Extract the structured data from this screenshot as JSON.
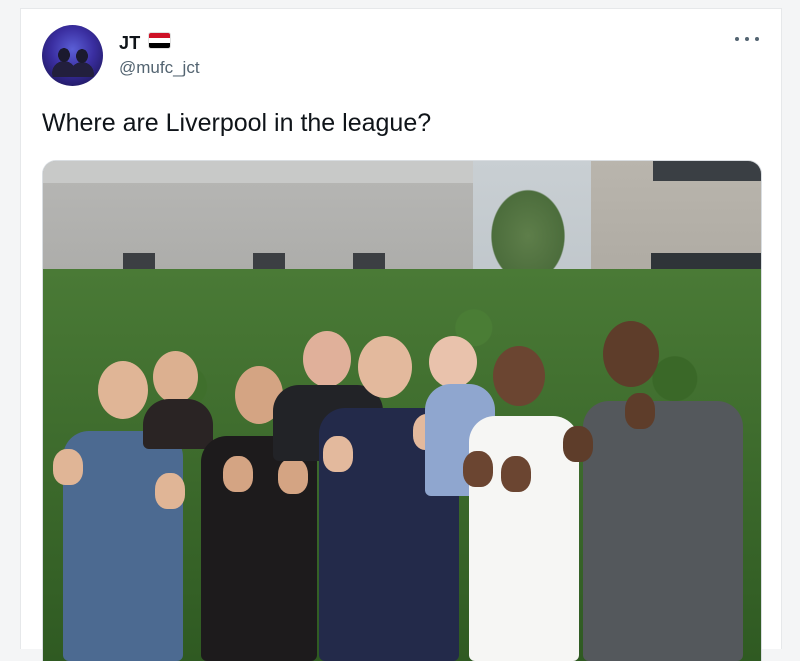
{
  "tweet": {
    "display_name": "JT",
    "handle": "@mufc_jct",
    "text": "Where are Liverpool in the league?",
    "more_icon": "more-dots-icon",
    "flag_icon": "egypt-flag-icon",
    "flag_colors": [
      "#ce1126",
      "#ffffff",
      "#000000"
    ]
  },
  "media": {
    "description_icon": "photo",
    "colors": {
      "hedge": "#3f6f2c",
      "skin_light": "#e0b596",
      "skin_dark": "#6b4531"
    }
  }
}
